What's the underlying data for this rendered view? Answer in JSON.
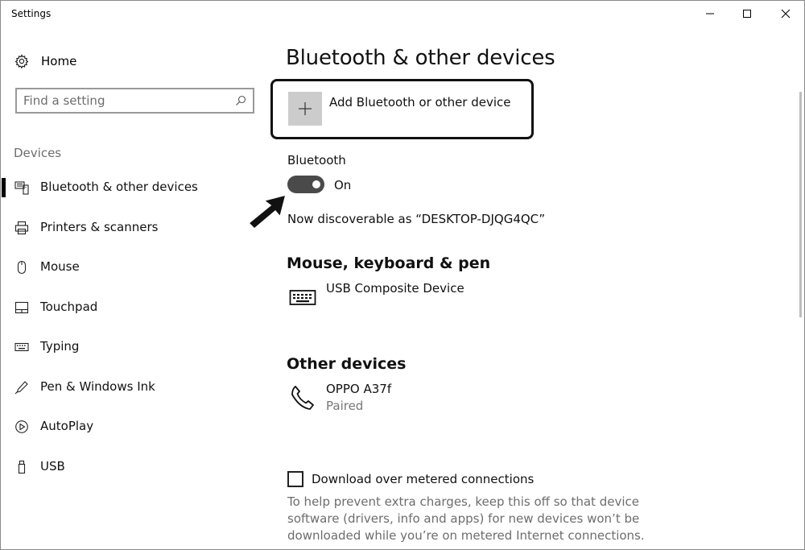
{
  "window": {
    "title": "Settings"
  },
  "sidebar": {
    "home_label": "Home",
    "search_placeholder": "Find a setting",
    "section_label": "Devices",
    "items": [
      {
        "label": "Bluetooth & other devices",
        "icon": "bluetooth-devices-icon",
        "active": true
      },
      {
        "label": "Printers & scanners",
        "icon": "printer-icon",
        "active": false
      },
      {
        "label": "Mouse",
        "icon": "mouse-icon",
        "active": false
      },
      {
        "label": "Touchpad",
        "icon": "touchpad-icon",
        "active": false
      },
      {
        "label": "Typing",
        "icon": "keyboard-icon",
        "active": false
      },
      {
        "label": "Pen & Windows Ink",
        "icon": "pen-icon",
        "active": false
      },
      {
        "label": "AutoPlay",
        "icon": "autoplay-icon",
        "active": false
      },
      {
        "label": "USB",
        "icon": "usb-icon",
        "active": false
      }
    ]
  },
  "main": {
    "title": "Bluetooth & other devices",
    "add_device_label": "Add Bluetooth or other device",
    "bluetooth": {
      "label": "Bluetooth",
      "state": "On",
      "discoverable_text": "Now discoverable as “DESKTOP-DJQG4QC”"
    },
    "mouse_keyboard_pen": {
      "heading": "Mouse, keyboard & pen",
      "devices": [
        {
          "name": "USB Composite Device",
          "icon": "keyboard-icon"
        }
      ]
    },
    "other_devices": {
      "heading": "Other devices",
      "devices": [
        {
          "name": "OPPO A37f",
          "status": "Paired",
          "icon": "phone-icon"
        }
      ]
    },
    "metered": {
      "label": "Download over metered connections",
      "checked": false,
      "help_text": "To help prevent extra charges, keep this off so that device software (drivers, info and apps) for new devices won’t be downloaded while you’re on metered Internet connections."
    }
  },
  "colors": {
    "toggle_on": "#4a4a4a",
    "add_tile": "#cccccc",
    "secondary_text": "#6d6d6d"
  }
}
